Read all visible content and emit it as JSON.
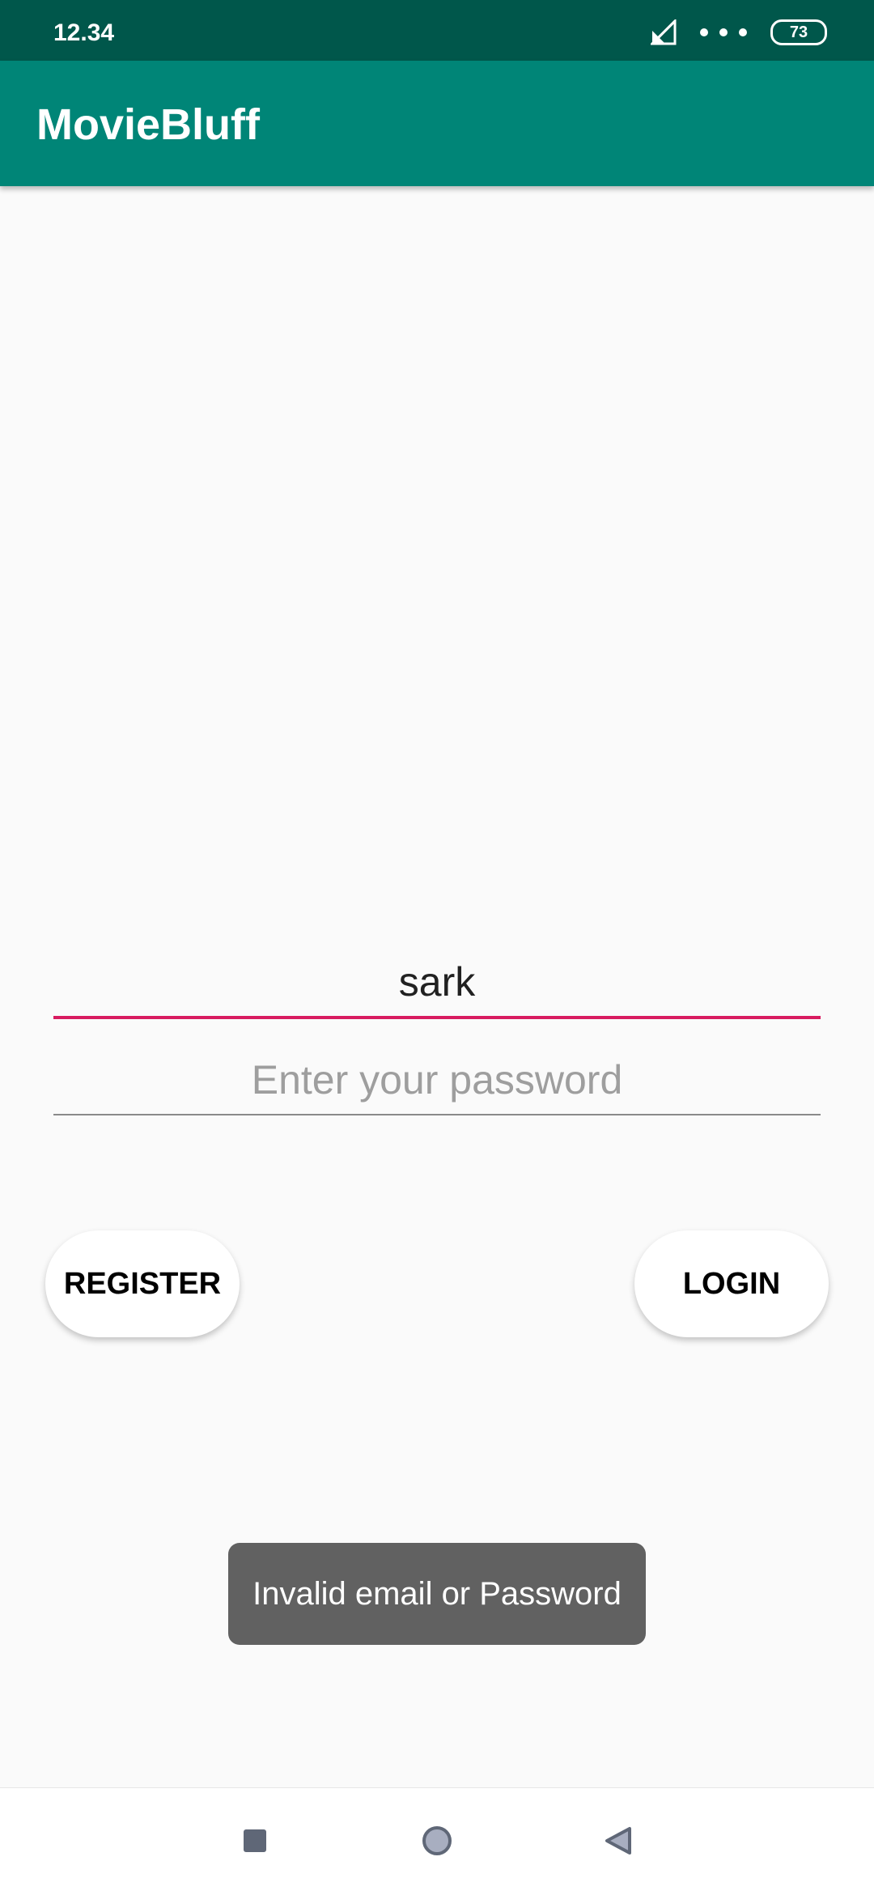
{
  "status_bar": {
    "time": "12.34",
    "battery": "73"
  },
  "app_bar": {
    "title": "MovieBluff"
  },
  "login_form": {
    "email_value": "sark",
    "password_value": "",
    "password_placeholder": "Enter your password",
    "register_label": "REGISTER",
    "login_label": "LOGIN"
  },
  "toast": {
    "message": "Invalid email or Password"
  },
  "icons": {
    "signal": "signal-off-icon",
    "more": "more-dots-icon",
    "battery": "battery-icon",
    "recent": "square-icon",
    "home": "circle-icon",
    "back": "triangle-back-icon"
  },
  "colors": {
    "status_bar": "#00574b",
    "app_bar": "#008577",
    "accent": "#d81b60",
    "toast": "#616161",
    "nav_icon": "#5f6777"
  }
}
